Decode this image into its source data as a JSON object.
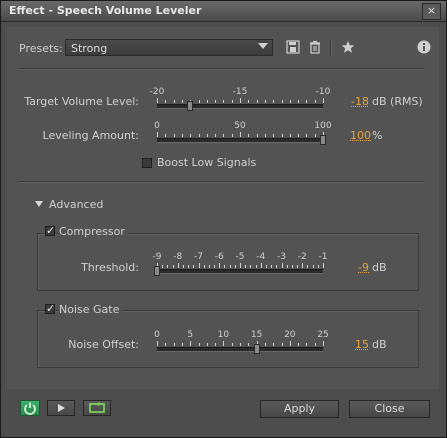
{
  "window": {
    "title": "Effect - Speech Volume Leveler",
    "close_label": "×"
  },
  "presets": {
    "label": "Presets:",
    "selected": "Strong"
  },
  "target_volume": {
    "label": "Target Volume Level:",
    "ticks": [
      "-20",
      "-15",
      "-10"
    ],
    "value": "-18",
    "unit": "dB (RMS)",
    "min": -20,
    "max": -10,
    "current": -18
  },
  "leveling": {
    "label": "Leveling Amount:",
    "ticks": [
      "0",
      "50",
      "100"
    ],
    "value": "100",
    "unit": "%",
    "min": 0,
    "max": 100,
    "current": 100
  },
  "boost": {
    "label": "Boost Low Signals",
    "checked": false
  },
  "advanced": {
    "label": "Advanced",
    "expanded": true
  },
  "compressor": {
    "label": "Compressor",
    "checked": true,
    "threshold_label": "Threshold:",
    "ticks": [
      "-9",
      "-8",
      "-7",
      "-6",
      "-5",
      "-4",
      "-3",
      "-2",
      "-1"
    ],
    "value": "-9",
    "unit": "dB",
    "min": -9,
    "max": -1,
    "current": -9
  },
  "noise_gate": {
    "label": "Noise Gate",
    "checked": true,
    "offset_label": "Noise Offset:",
    "ticks": [
      "0",
      "5",
      "10",
      "15",
      "20",
      "25"
    ],
    "value": "15",
    "unit": "dB",
    "min": 0,
    "max": 25,
    "current": 15
  },
  "footer": {
    "apply_label": "Apply",
    "close_label": "Close"
  },
  "checkmark": "✓"
}
